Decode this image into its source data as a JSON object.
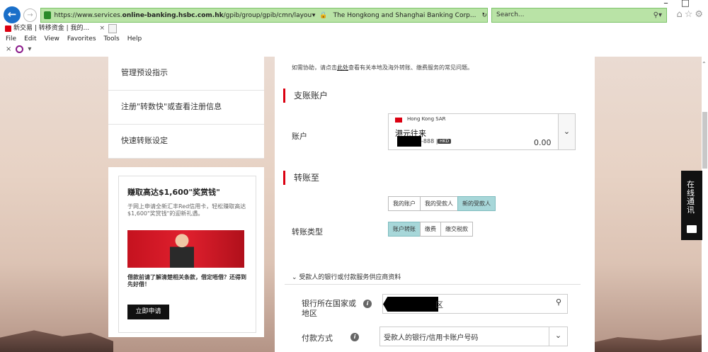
{
  "browser": {
    "url_prefix": "https://www.services.",
    "url_bold": "online-banking.hsbc.com.hk",
    "url_suffix": "/gpib/group/gpib/cmn/layouts/default.html?uid=",
    "site_identity": "The Hongkong and Shanghai Banking Corp...",
    "search_placeholder": "Search...",
    "tab_title": "新交易 | 转移资金 | 我的...",
    "menu": [
      "File",
      "Edit",
      "View",
      "Favorites",
      "Tools",
      "Help"
    ],
    "colors": {
      "address_bar": "#b9e3a6",
      "back_button": "#1a6fc9"
    }
  },
  "left_nav": {
    "items": [
      "管理预设指示",
      "注册\"转数快\"或查看注册信息",
      "快速转账设定"
    ]
  },
  "promo": {
    "title": "赚取高达$1,600\"奖赏钱\"",
    "description": "于网上申请全新汇丰Red信用卡，轻松赚取高达$1,600\"奖赏钱\"的迎新礼遇。",
    "terms": "借款前请了解清楚相关条款，借定唔借？还得到先好借！",
    "apply_button": "立即申请"
  },
  "main": {
    "help_prefix": "如需协助，请点击",
    "help_link": "此处",
    "help_suffix": "查看有关本地及海外转账、缴费服务的常见问题。",
    "from_section": "支账账户",
    "account_label": "账户",
    "account": {
      "region": "Hong Kong SAR",
      "name": "港元往来",
      "number_tail": "-888",
      "currency": "HKD",
      "balance": "0.00"
    },
    "to_section": "转账至",
    "payee_tabs": [
      "我的账户",
      "我的受款人",
      "新的受款人"
    ],
    "payee_selected": "新的受款人",
    "transfer_type_label": "转账类型",
    "transfer_types": [
      "账户转账",
      "缴费",
      "缴交税款"
    ],
    "transfer_type_selected": "账户转账",
    "payee_bank_section": "受款人的银行或付款服务供应商资料",
    "bank_country_label": "银行所在国家或地区",
    "bank_country_value": "区",
    "payment_method_label": "付款方式",
    "payment_method_value": "受款人的银行/信用卡账户号码"
  },
  "chat": {
    "label": "在线通讯"
  },
  "brand_color": "#db0011"
}
